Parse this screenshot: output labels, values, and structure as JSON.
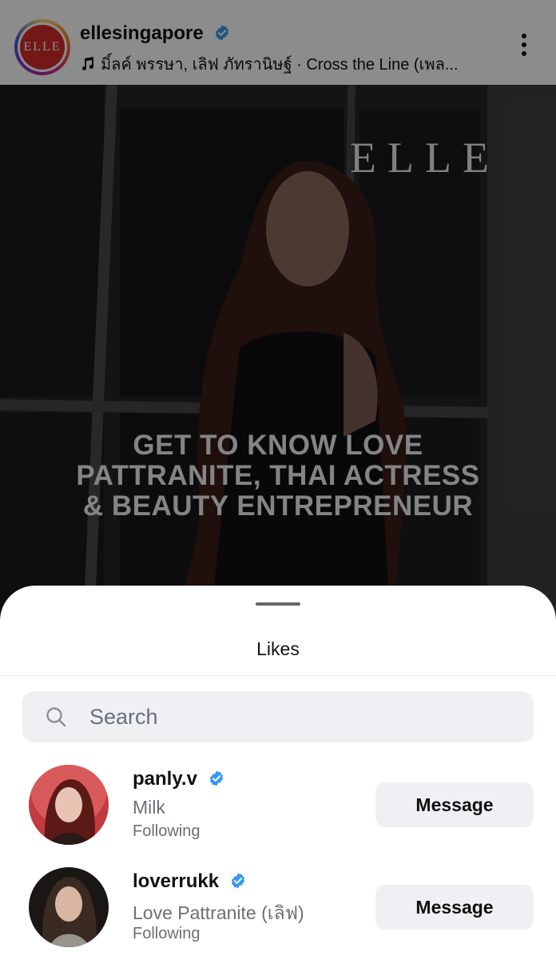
{
  "post": {
    "username": "ellesingapore",
    "avatar_text": "ELLE",
    "music": "มิ์ลค์ พรรษา, เลิฟ ภัทรานิษฐ์ · Cross the Line (เพล...",
    "brand_mark": "ELLE",
    "headline_lines": [
      "GET TO KNOW LOVE",
      "PATTRANITE, THAI ACTRESS",
      "& BEAUTY ENTREPRENEUR"
    ]
  },
  "sheet": {
    "title": "Likes",
    "search_placeholder": "Search",
    "users": [
      {
        "username": "panly.v",
        "display_name": "Milk",
        "status": "Following",
        "verified": true,
        "button": "Message"
      },
      {
        "username": "loverrukk",
        "display_name": "Love Pattranite (เลิฟ)",
        "status": "Following",
        "verified": true,
        "button": "Message"
      }
    ]
  },
  "colors": {
    "verified_blue": "#3797f0",
    "elle_red": "#d12a2a",
    "button_bg": "#eff0f3"
  },
  "icons": [
    "verified-badge-icon",
    "music-note-icon",
    "more-options-icon",
    "search-icon"
  ]
}
